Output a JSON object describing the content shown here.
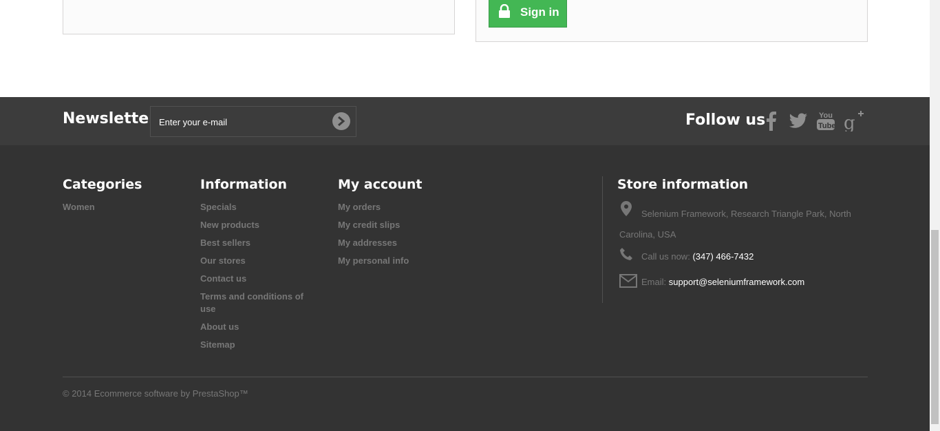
{
  "signin": {
    "label": "Sign in"
  },
  "newsletter": {
    "title": "Newsletter",
    "placeholder": "Enter your e-mail"
  },
  "follow": {
    "title": "Follow us",
    "networks": [
      "facebook",
      "twitter",
      "youtube",
      "google-plus"
    ]
  },
  "categories": {
    "title": "Categories",
    "items": [
      "Women"
    ]
  },
  "information": {
    "title": "Information",
    "items": [
      "Specials",
      "New products",
      "Best sellers",
      "Our stores",
      "Contact us",
      "Terms and conditions of use",
      "About us",
      "Sitemap"
    ]
  },
  "account": {
    "title": "My account",
    "items": [
      "My orders",
      "My credit slips",
      "My addresses",
      "My personal info"
    ]
  },
  "store": {
    "title": "Store information",
    "address": "Selenium Framework, Research Triangle Park, North Carolina, USA",
    "call_label": "Call us now:",
    "phone": "(347) 466-7432",
    "email_label": "Email:",
    "email": "support@seleniumframework.com"
  },
  "copyright": "© 2014 Ecommerce software by PrestaShop™",
  "colors": {
    "footer_bg": "#333333",
    "band_bg": "#3c3c3c",
    "signin_green": "#43b754",
    "muted_text": "#777777"
  }
}
